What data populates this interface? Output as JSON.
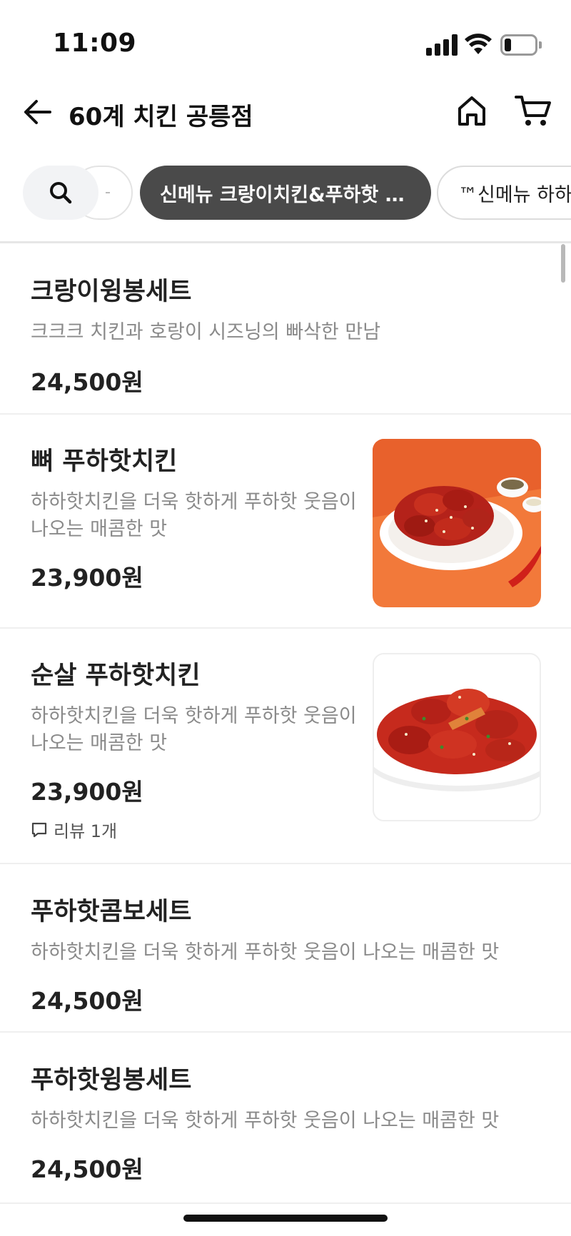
{
  "status_bar": {
    "time": "11:09"
  },
  "header": {
    "title": "60계 치킨 공릉점"
  },
  "categories": {
    "active": "신메뉴 크랑이치킨&푸하핫 …",
    "next": "™신메뉴 하하핫"
  },
  "menu": [
    {
      "name": "크랑이윙봉세트",
      "desc": "크크크 치킨과 호랑이 시즈닝의 빠삭한 만남",
      "price": "24,500원"
    },
    {
      "name": "뼈 푸하핫치킨",
      "desc": "하하핫치킨을 더욱 핫하게 푸하핫 웃음이 나오는 매콤한 맛",
      "price": "23,900원",
      "image": "spicy-bone-chicken-plate-on-orange"
    },
    {
      "name": "순살 푸하핫치킨",
      "desc": "하하핫치킨을 더욱 핫하게 푸하핫 웃음이 나오는 매콤한 맛",
      "price": "23,900원",
      "review": "리뷰 1개",
      "image": "spicy-boneless-chicken-plate-on-white"
    },
    {
      "name": "푸하핫콤보세트",
      "desc": "하하핫치킨을 더욱 핫하게 푸하핫 웃음이 나오는 매콤한 맛",
      "price": "24,500원"
    },
    {
      "name": "푸하핫윙봉세트",
      "desc": "하하핫치킨을 더욱 핫하게 푸하핫 웃음이 나오는 매콤한 맛",
      "price": "24,500원"
    }
  ],
  "icons": [
    "back-arrow-icon",
    "home-icon",
    "cart-icon",
    "search-icon",
    "review-bubble-icon",
    "signal-icon",
    "wifi-icon",
    "battery-icon"
  ],
  "colors": {
    "active_chip": "#4a4a4a",
    "desc_text": "#8a8a8a",
    "orange_bg": "#f2793a"
  }
}
